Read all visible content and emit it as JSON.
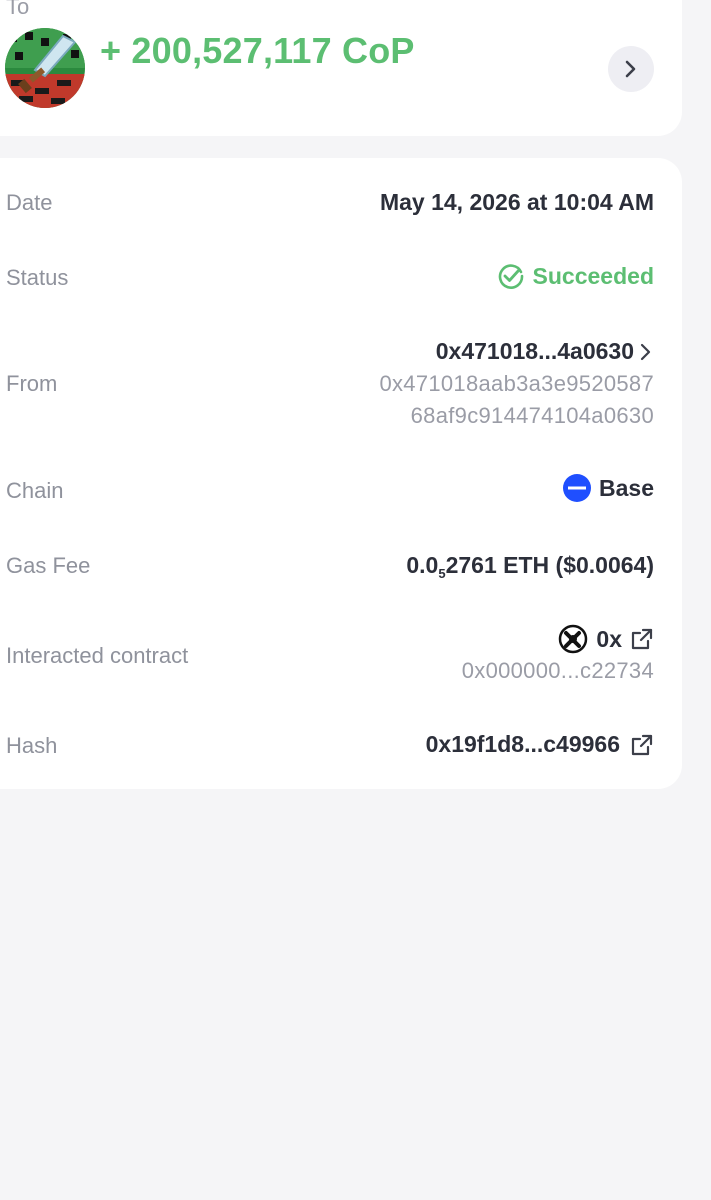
{
  "transfer": {
    "to_label": "To",
    "amount": "+ 200,527,117 CoP"
  },
  "details": {
    "date": {
      "label": "Date",
      "value": "May 14, 2026 at 10:04 AM"
    },
    "status": {
      "label": "Status",
      "value": "Succeeded",
      "color": "#5cbe72"
    },
    "from": {
      "label": "From",
      "short": "0x471018...4a0630",
      "full_line1": "0x471018aab3a3e9520587",
      "full_line2": "68af9c914474104a0630"
    },
    "chain": {
      "label": "Chain",
      "value": "Base",
      "icon": "base-chain-icon",
      "color": "#1f4fff"
    },
    "gas_fee": {
      "label": "Gas Fee",
      "prefix": "0.0",
      "subscript": "5",
      "suffix": "2761 ETH ($0.0064)"
    },
    "interacted_contract": {
      "label": "Interacted contract",
      "name": "0x",
      "address": "0x000000...c22734",
      "icon": "0x-protocol-icon"
    },
    "hash": {
      "label": "Hash",
      "value": "0x19f1d8...c49966",
      "icon": "external-link-icon"
    }
  }
}
